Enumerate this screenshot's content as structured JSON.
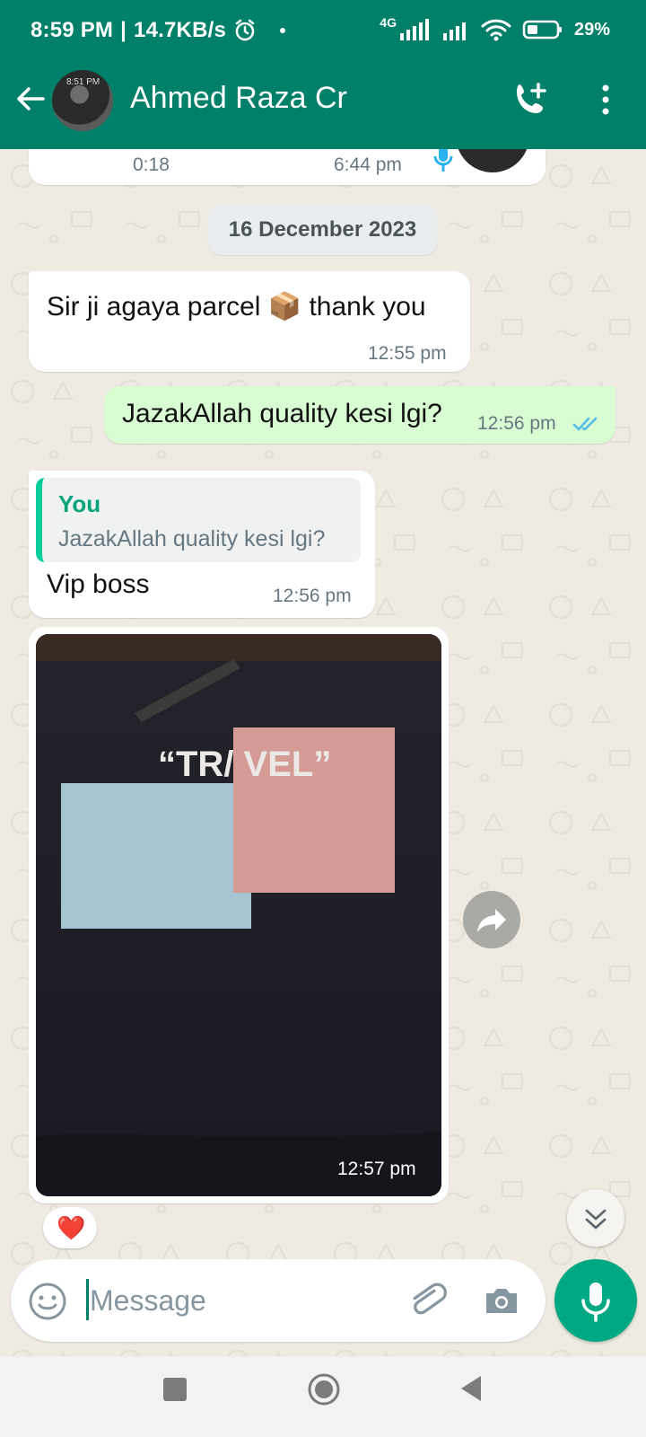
{
  "status_bar": {
    "time": "8:59 PM",
    "speed": "14.7KB/s",
    "battery": "29%",
    "network": "4G"
  },
  "header": {
    "contact_name": "Ahmed Raza Cr",
    "avatar_caption": "8:51 PM"
  },
  "messages": {
    "voice_note": {
      "duration": "0:18",
      "time": "6:44 pm"
    },
    "date_chip": "16 December 2023",
    "incoming_1": {
      "text": "Sir ji agaya parcel 📦 thank you",
      "time": "12:55 pm"
    },
    "outgoing_1": {
      "text": "JazakAllah quality kesi lgi?",
      "time": "12:56 pm",
      "ticks": "read"
    },
    "incoming_2": {
      "quote_author": "You",
      "quote_text": "JazakAllah quality kesi lgi?",
      "text": "Vip boss",
      "time": "12:56 pm"
    },
    "incoming_image": {
      "time": "12:57 pm",
      "image_text": "“TR/ VEL”",
      "reaction": "❤️"
    }
  },
  "input": {
    "placeholder": "Message"
  },
  "colors": {
    "header_green": "#008069",
    "outgoing_bubble": "#d9fdd3",
    "mic_button": "#00a884",
    "read_ticks": "#53bdeb"
  },
  "icons": [
    "back-arrow-icon",
    "add-call-icon",
    "more-options-icon",
    "mic-icon",
    "emoji-icon",
    "attach-icon",
    "camera-icon",
    "forward-icon",
    "scroll-down-icon",
    "heart-reaction-icon"
  ]
}
